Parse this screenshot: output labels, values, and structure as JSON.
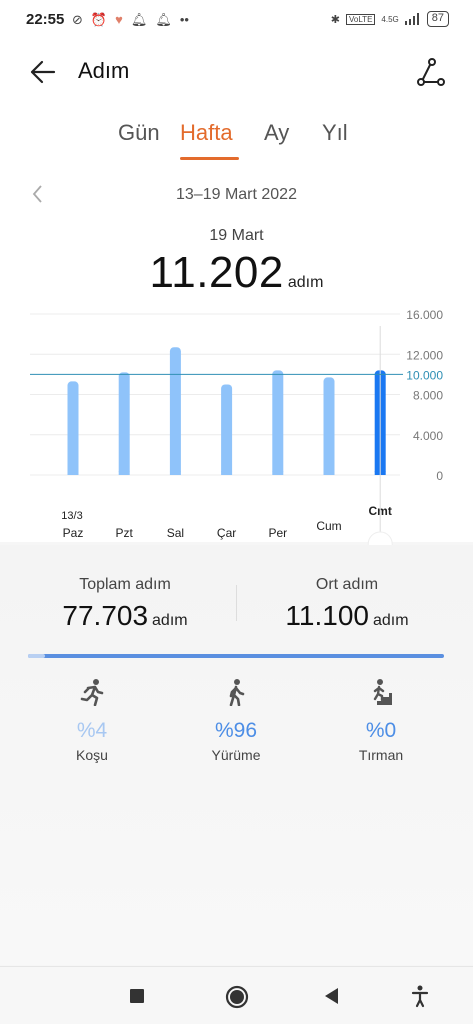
{
  "status_bar": {
    "time": "22:55",
    "network": "4.5G",
    "volte": "VoLTE",
    "battery": "87"
  },
  "header": {
    "title": "Adım"
  },
  "tabs": [
    {
      "label": "Gün",
      "active": false
    },
    {
      "label": "Hafta",
      "active": true
    },
    {
      "label": "Ay",
      "active": false
    },
    {
      "label": "Yıl",
      "active": false
    }
  ],
  "date_range": "13–19 Mart 2022",
  "selected": {
    "day_label": "19 Mart",
    "value": "11.202",
    "unit": "adım"
  },
  "chart_data": {
    "type": "bar",
    "categories": [
      "Paz",
      "Pzt",
      "Sal",
      "Çar",
      "Per",
      "Cum",
      "Cmt"
    ],
    "date_label_first": "13/3",
    "values": [
      9300,
      10200,
      12700,
      9000,
      10400,
      9700,
      10400
    ],
    "selected_index": 6,
    "reference_line": {
      "value": 10000,
      "label": "10.000"
    },
    "ylim": [
      0,
      16000
    ],
    "yticks": [
      "16.000",
      "12.000",
      "8.000",
      "4.000",
      "0"
    ],
    "bar_color": "#8fc3fa",
    "selected_bar_color": "#1a78f2",
    "reference_color": "#2f8fb4"
  },
  "stats": {
    "total_label": "Toplam adım",
    "total_value": "77.703",
    "total_unit": "adım",
    "avg_label": "Ort adım",
    "avg_value": "11.100",
    "avg_unit": "adım"
  },
  "activities": [
    {
      "label": "Koşu",
      "percent": "%4",
      "icon": "running-icon"
    },
    {
      "label": "Yürüme",
      "percent": "%96",
      "icon": "walking-icon"
    },
    {
      "label": "Tırman",
      "percent": "%0",
      "icon": "climbing-icon"
    }
  ],
  "progress": {
    "run_fraction": 0.04
  },
  "colors": {
    "accent": "#e36b2c",
    "percent_text": "#4d8ee6",
    "icon_gray": "#555555"
  }
}
